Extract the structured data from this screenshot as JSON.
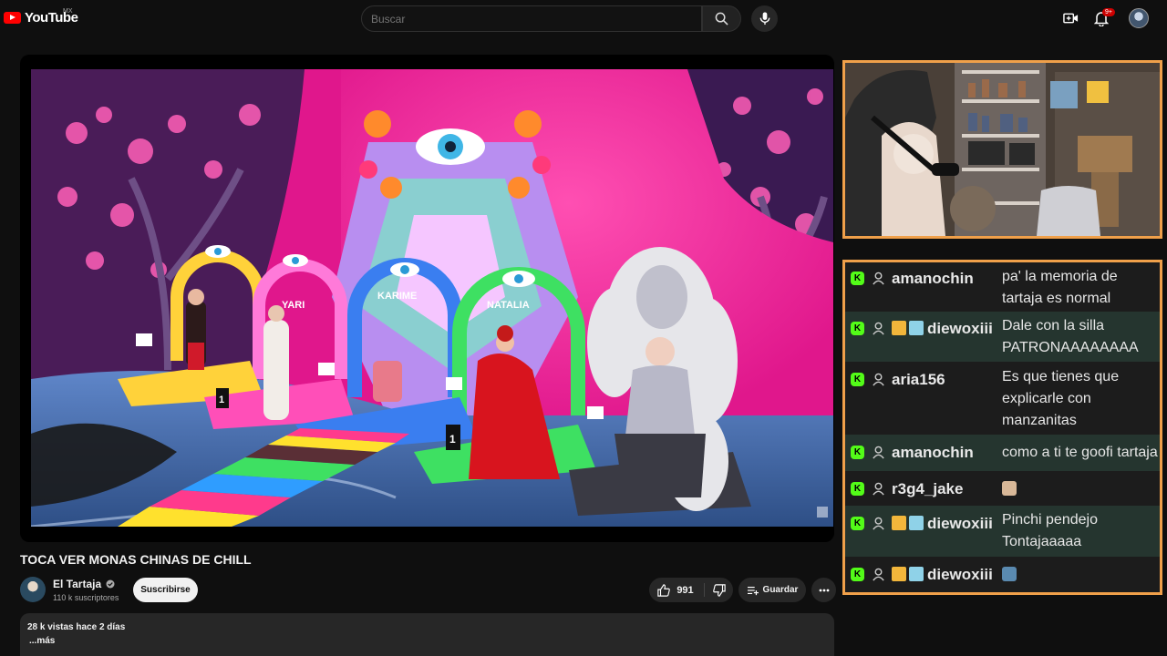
{
  "header": {
    "logo_text": "YouTube",
    "country_code": "MX",
    "search_placeholder": "Buscar",
    "notification_count": "9+"
  },
  "video": {
    "title": "TOCA VER MONAS CHINAS DE CHILL",
    "stage_labels": [
      "YARI",
      "KARIME",
      "NATALIA"
    ],
    "podium_numbers": [
      "1",
      "1"
    ]
  },
  "channel": {
    "name": "El Tartaja",
    "subscribers": "110 k suscriptores",
    "subscribe_label": "Suscribirse"
  },
  "actions": {
    "likes": "991",
    "save_label": "Guardar"
  },
  "description": {
    "meta": "28 k vistas  hace 2 días",
    "more_label": "...más"
  },
  "chat": {
    "messages": [
      {
        "user": "amanochin",
        "text": "pa' la memoria de tartaja es normal"
      },
      {
        "user": "diewoxiii",
        "text": "Dale con la silla PATRONAAAAAAAA"
      },
      {
        "user": "aria156",
        "text": "Es que tienes que explicarle con manzanitas"
      },
      {
        "user": "amanochin",
        "text": "como a ti te goofi tartaja"
      },
      {
        "user": "r3g4_jake",
        "text": ""
      },
      {
        "user": "diewoxiii",
        "text": "Pinchi pendejo Tontajaaaaa"
      },
      {
        "user": "diewoxiii",
        "text": ""
      }
    ]
  },
  "colors": {
    "accent_border": "#f0a04a",
    "kick_green": "#53fc18",
    "youtube_red": "#ff0000"
  },
  "icons": [
    "search-icon",
    "mic-icon",
    "create-video-icon",
    "bell-icon",
    "like-icon",
    "dislike-icon",
    "save-playlist-icon",
    "more-icon",
    "verified-icon",
    "kick-badge-icon",
    "person-icon",
    "crown-icon"
  ]
}
